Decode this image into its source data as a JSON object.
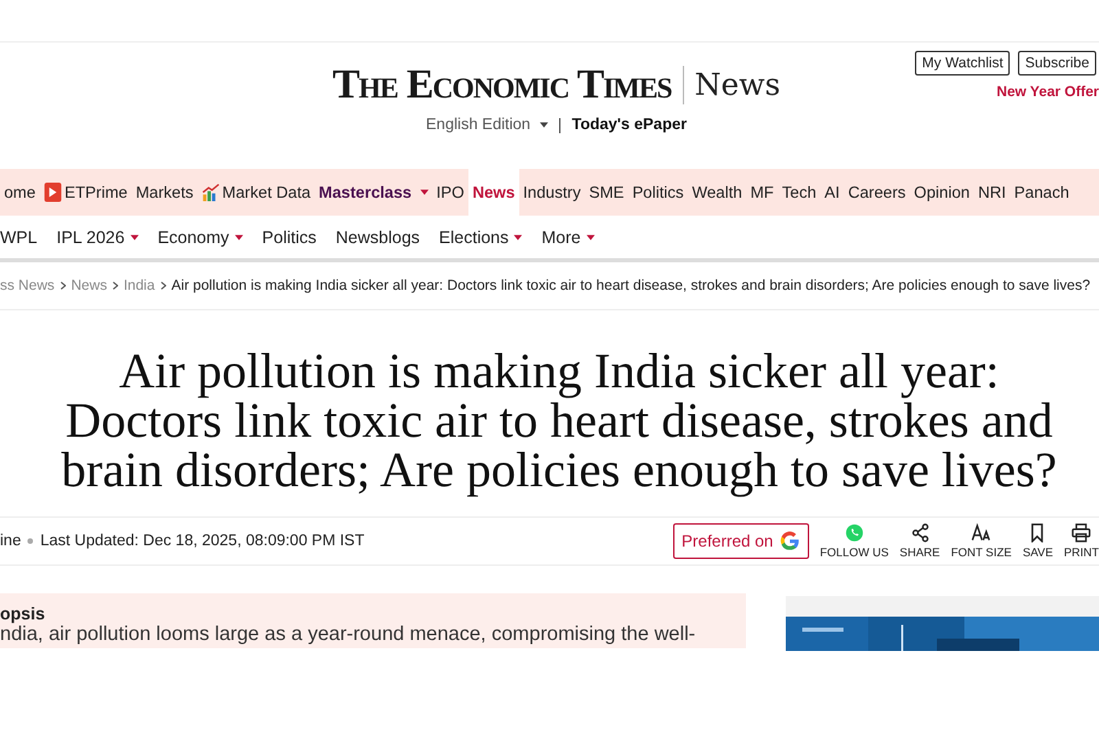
{
  "header": {
    "logo": "The Economic Times",
    "section": "News",
    "edition": "English Edition",
    "epaper": "Today's ePaper",
    "buttons": [
      "My Watchlist",
      "Subscribe"
    ],
    "offer": "New Year Offer"
  },
  "nav": [
    {
      "label": "ome",
      "kind": "plain",
      "dropdown": false,
      "selected": false
    },
    {
      "label": "ETPrime",
      "kind": "prime",
      "dropdown": false,
      "selected": false
    },
    {
      "label": "Markets",
      "kind": "plain",
      "dropdown": false,
      "selected": false
    },
    {
      "label": "Market Data",
      "kind": "chart",
      "dropdown": false,
      "selected": false
    },
    {
      "label": "Masterclass",
      "kind": "bold",
      "dropdown": true,
      "selected": false
    },
    {
      "label": "IPO",
      "kind": "plain",
      "dropdown": false,
      "selected": false
    },
    {
      "label": "News",
      "kind": "plain",
      "dropdown": false,
      "selected": true
    },
    {
      "label": "Industry",
      "kind": "plain",
      "dropdown": false,
      "selected": false
    },
    {
      "label": "SME",
      "kind": "plain",
      "dropdown": false,
      "selected": false
    },
    {
      "label": "Politics",
      "kind": "plain",
      "dropdown": false,
      "selected": false
    },
    {
      "label": "Wealth",
      "kind": "plain",
      "dropdown": false,
      "selected": false
    },
    {
      "label": "MF",
      "kind": "plain",
      "dropdown": false,
      "selected": false
    },
    {
      "label": "Tech",
      "kind": "plain",
      "dropdown": false,
      "selected": false
    },
    {
      "label": "AI",
      "kind": "plain",
      "dropdown": false,
      "selected": false
    },
    {
      "label": "Careers",
      "kind": "plain",
      "dropdown": false,
      "selected": false
    },
    {
      "label": "Opinion",
      "kind": "plain",
      "dropdown": false,
      "selected": false
    },
    {
      "label": "NRI",
      "kind": "plain",
      "dropdown": false,
      "selected": false
    },
    {
      "label": "Panach",
      "kind": "plain",
      "dropdown": false,
      "selected": false
    }
  ],
  "subnav": [
    {
      "label": "WPL",
      "dropdown": false
    },
    {
      "label": "IPL 2026",
      "dropdown": true
    },
    {
      "label": "Economy",
      "dropdown": true
    },
    {
      "label": "Politics",
      "dropdown": false
    },
    {
      "label": "Newsblogs",
      "dropdown": false
    },
    {
      "label": "Elections",
      "dropdown": true
    },
    {
      "label": "More",
      "dropdown": true
    }
  ],
  "breadcrumb": [
    "ss News",
    "News",
    "India"
  ],
  "breadcrumb_current": "Air pollution is making India sicker all year: Doctors link toxic air to heart disease, strokes and brain disorders; Are policies enough to save lives?",
  "headline": "Air pollution is making India sicker all year: Doctors link toxic air to heart disease, strokes and brain disorders; Are policies enough to save lives?",
  "byline": "ine",
  "updated": "Last Updated: Dec 18, 2025, 08:09:00 PM IST",
  "preferred": "Preferred on",
  "actions": [
    {
      "kind": "whatsapp",
      "label": "FOLLOW US"
    },
    {
      "kind": "share",
      "label": "SHARE"
    },
    {
      "kind": "font",
      "label": "FONT SIZE"
    },
    {
      "kind": "save",
      "label": "SAVE"
    },
    {
      "kind": "print",
      "label": "PRINT"
    }
  ],
  "synopsis": {
    "title": "opsis",
    "text": "ndia, air pollution looms large as a year-round menace, compromising the well-"
  }
}
